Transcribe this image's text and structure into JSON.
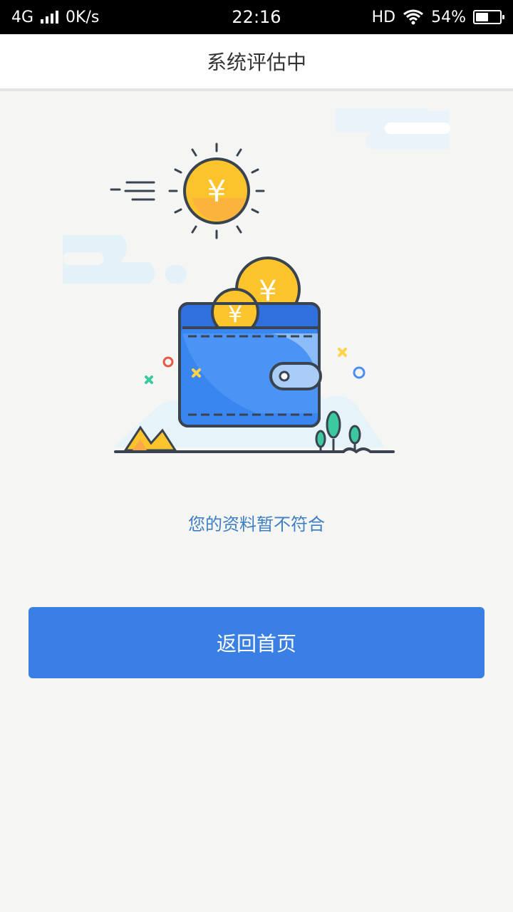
{
  "status_bar": {
    "network": "4G",
    "speed": "0K/s",
    "time": "22:16",
    "hd_label": "HD",
    "battery_percent": "54%",
    "battery_level": 0.54
  },
  "header": {
    "title": "系统评估中"
  },
  "illustration": {
    "coin_symbol": "¥"
  },
  "message": "您的资料暂不符合",
  "button": {
    "label": "返回首页"
  },
  "colors": {
    "accent": "#3a80e4",
    "message_text": "#3e7fc4",
    "background": "#f5f5f3",
    "wallet_blue": "#2f6fde",
    "coin_gold": "#fcc42c"
  }
}
